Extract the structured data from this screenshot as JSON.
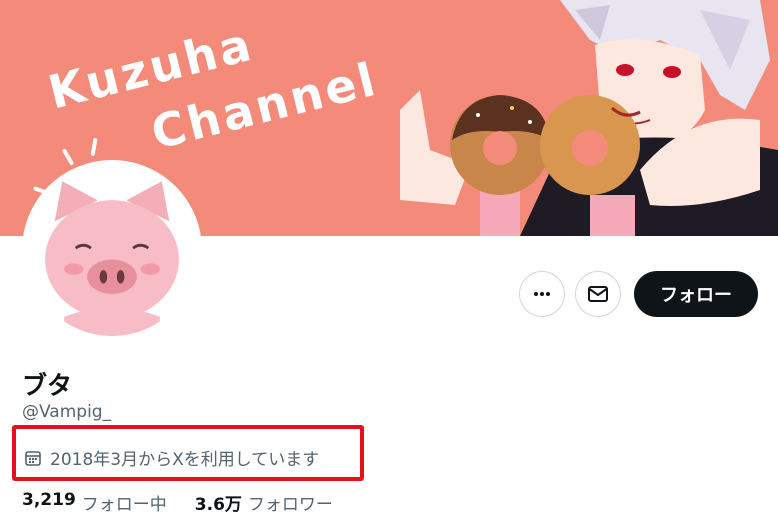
{
  "banner": {
    "line1": "Kuzuha",
    "line2": "Channel",
    "background": "#f48a79"
  },
  "profile": {
    "display_name": "ブタ",
    "handle": "@Vampig_",
    "joined": "2018年3月からXを利用しています",
    "calendar_icon": "calendar-icon"
  },
  "actions": {
    "more_icon": "more-icon",
    "message_icon": "mail-icon",
    "follow_label": "フォロー"
  },
  "stats": {
    "following_count": "3,219",
    "following_label": "フォロー中",
    "followers_count": "3.6万",
    "followers_label": "フォロワー"
  },
  "colors": {
    "highlight": "#e4101e",
    "text_primary": "#0f1419",
    "text_secondary": "#536471",
    "follow_button": "#0f1419"
  }
}
